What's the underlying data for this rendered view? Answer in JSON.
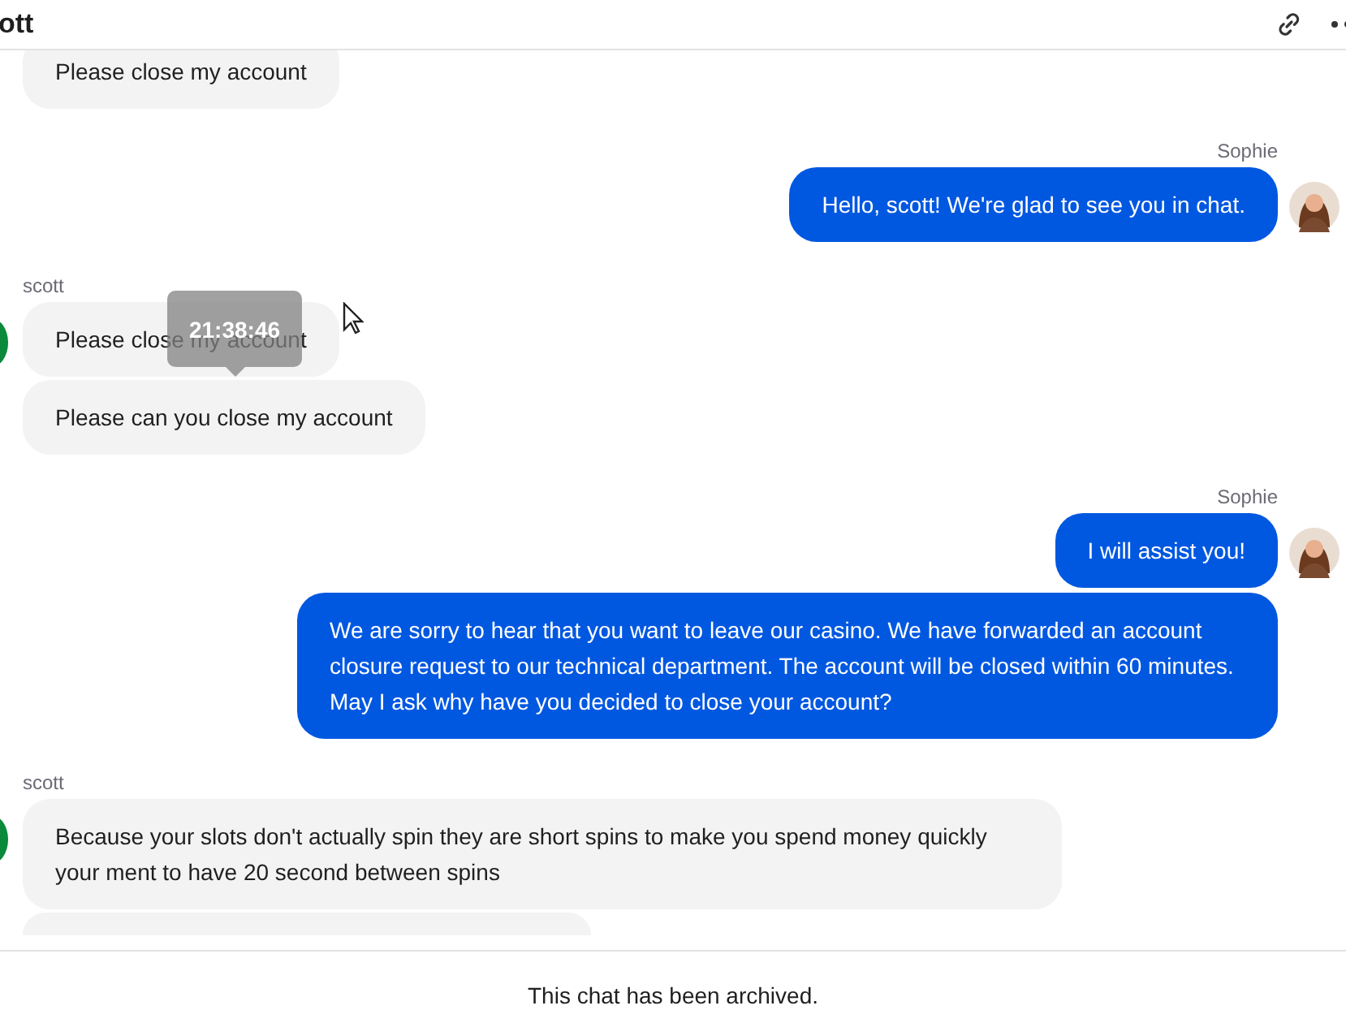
{
  "header": {
    "title": "ott"
  },
  "groups": [
    {
      "kind": "incoming",
      "avatar": false,
      "bubbles": [
        {
          "text": "Please close my account"
        }
      ]
    },
    {
      "kind": "outgoing",
      "sender": "Sophie",
      "avatar": true,
      "bubbles": [
        {
          "text": "Hello, scott! We're glad to see you in chat."
        }
      ]
    },
    {
      "kind": "incoming",
      "sender": "scott",
      "avatar": true,
      "bubbles": [
        {
          "text": "Please close my account",
          "tooltip": "21:38:46"
        },
        {
          "text": "Please can you close my account"
        }
      ]
    },
    {
      "kind": "outgoing",
      "sender": "Sophie",
      "avatar": true,
      "bubbles": [
        {
          "text": "I will assist you!"
        },
        {
          "text": "We are sorry to hear that you want to leave our casino. We have forwarded an account closure request to our technical department. The account will be closed within 60 minutes. May I ask why have you decided to close your account?"
        }
      ]
    },
    {
      "kind": "incoming",
      "sender": "scott",
      "avatar": true,
      "more_below": true,
      "bubbles": [
        {
          "text": "Because your slots don't actually spin they are short spins to make you spend money quickly your ment to have 20 second between spins"
        }
      ]
    }
  ],
  "footer": {
    "notice": "This chat has been archived."
  }
}
